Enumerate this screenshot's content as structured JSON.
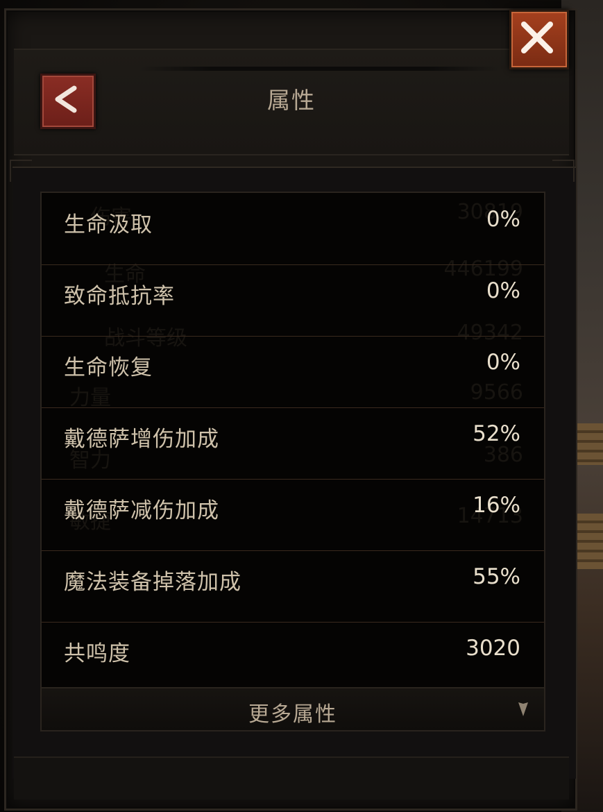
{
  "header": {
    "title": "属性",
    "back_icon": "back-arrow-icon",
    "close_icon": "close-x-icon"
  },
  "colors": {
    "accent_red": "#8a2d24",
    "close_orange": "#a5401e",
    "label_text": "#cfc2ab",
    "value_text": "#e9dfcc",
    "divider": "#3a2a1e"
  },
  "stats": [
    {
      "label": "生命汲取",
      "value": "0%"
    },
    {
      "label": "致命抵抗率",
      "value": "0%"
    },
    {
      "label": "生命恢复",
      "value": "0%"
    },
    {
      "label": "戴德萨增伤加成",
      "value": "52%"
    },
    {
      "label": "戴德萨减伤加成",
      "value": "16%"
    },
    {
      "label": "魔法装备掉落加成",
      "value": "55%"
    },
    {
      "label": "共鸣度",
      "value": "3020"
    }
  ],
  "ghost_stats": [
    {
      "label": "伤害",
      "value": "30819"
    },
    {
      "label": "生命",
      "value": "446199"
    },
    {
      "label": "战斗等级",
      "value": "49342"
    },
    {
      "label": "力量",
      "value": "9566"
    },
    {
      "label": "智力",
      "value": "386"
    },
    {
      "label": "敏捷",
      "value": "14713"
    }
  ],
  "more": {
    "label": "更多属性",
    "arrow_icon": "chevron-down-icon"
  }
}
